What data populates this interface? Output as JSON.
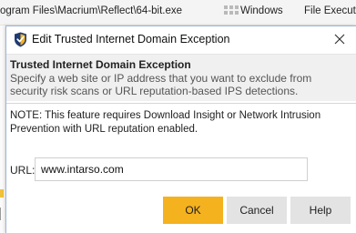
{
  "background": {
    "path_text": "ogram Files\\Macrium\\Reflect\\64-bit.exe",
    "col_windows": "Windows",
    "col_file_exec": "File Execution"
  },
  "dialog": {
    "title": "Edit Trusted Internet Domain Exception",
    "header_title": "Trusted Internet Domain Exception",
    "header_desc": "Specify a web site or IP address that you want to exclude from security risk scans or URL reputation-based IPS detections.",
    "note": "NOTE: This feature requires Download Insight or Network Intrusion Prevention with URL reputation enabled.",
    "url_label": "URL:",
    "url_value": "www.intarso.com",
    "ok_label": "OK",
    "cancel_label": "Cancel",
    "help_label": "Help"
  },
  "icons": {
    "title_icon": "norton-shield-icon",
    "close_icon": "close-icon"
  },
  "colors": {
    "accent": "#f5b21f",
    "shield": "#1f3b73",
    "button_gray": "#e3e3e3",
    "header_bg": "#f0f0f0"
  }
}
